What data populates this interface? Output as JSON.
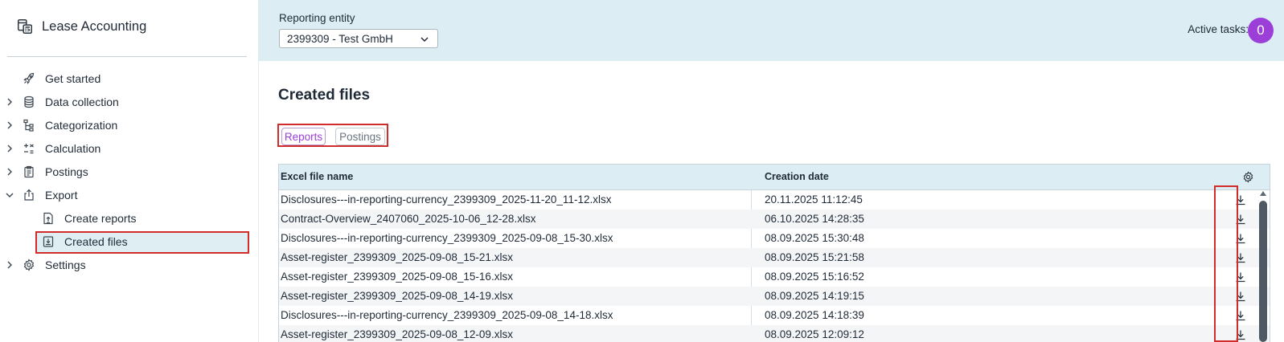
{
  "app": {
    "title": "Lease Accounting"
  },
  "sidebar": {
    "items": [
      {
        "label": "Get started",
        "icon": "rocket-icon",
        "expandable": false
      },
      {
        "label": "Data collection",
        "icon": "database-icon",
        "expandable": true
      },
      {
        "label": "Categorization",
        "icon": "hierarchy-icon",
        "expandable": true
      },
      {
        "label": "Calculation",
        "icon": "calculator-icon",
        "expandable": true
      },
      {
        "label": "Postings",
        "icon": "clipboard-icon",
        "expandable": true
      },
      {
        "label": "Export",
        "icon": "export-icon",
        "expandable": true,
        "expanded": true
      },
      {
        "label": "Create reports",
        "icon": "file-upload-icon",
        "sub": true
      },
      {
        "label": "Created files",
        "icon": "file-download-icon",
        "sub": true,
        "active": true
      },
      {
        "label": "Settings",
        "icon": "gear-icon",
        "expandable": true
      }
    ]
  },
  "topbar": {
    "entity_label": "Reporting entity",
    "entity_value": "2399309 - Test GmbH",
    "active_tasks_label": "Active tasks:",
    "active_tasks_count": "0"
  },
  "main": {
    "title": "Created files",
    "tabs": [
      {
        "label": "Reports",
        "active": true
      },
      {
        "label": "Postings",
        "active": false
      }
    ],
    "table": {
      "columns": [
        "Excel file name",
        "Creation date"
      ],
      "rows": [
        {
          "name": "Disclosures---in-reporting-currency_2399309_2025-11-20_11-12.xlsx",
          "date": "20.11.2025 11:12:45"
        },
        {
          "name": "Contract-Overview_2407060_2025-10-06_12-28.xlsx",
          "date": "06.10.2025 14:28:35"
        },
        {
          "name": "Disclosures---in-reporting-currency_2399309_2025-09-08_15-30.xlsx",
          "date": "08.09.2025 15:30:48"
        },
        {
          "name": "Asset-register_2399309_2025-09-08_15-21.xlsx",
          "date": "08.09.2025 15:21:58"
        },
        {
          "name": "Asset-register_2399309_2025-09-08_15-16.xlsx",
          "date": "08.09.2025 15:16:52"
        },
        {
          "name": "Asset-register_2399309_2025-09-08_14-19.xlsx",
          "date": "08.09.2025 14:19:15"
        },
        {
          "name": "Disclosures---in-reporting-currency_2399309_2025-09-08_14-18.xlsx",
          "date": "08.09.2025 14:18:39"
        },
        {
          "name": "Asset-register_2399309_2025-09-08_12-09.xlsx",
          "date": "08.09.2025 12:09:12"
        }
      ]
    }
  },
  "colors": {
    "accent": "#9b3fd8",
    "header_bg": "#dcedf3",
    "highlight_border": "#d12c2c"
  }
}
